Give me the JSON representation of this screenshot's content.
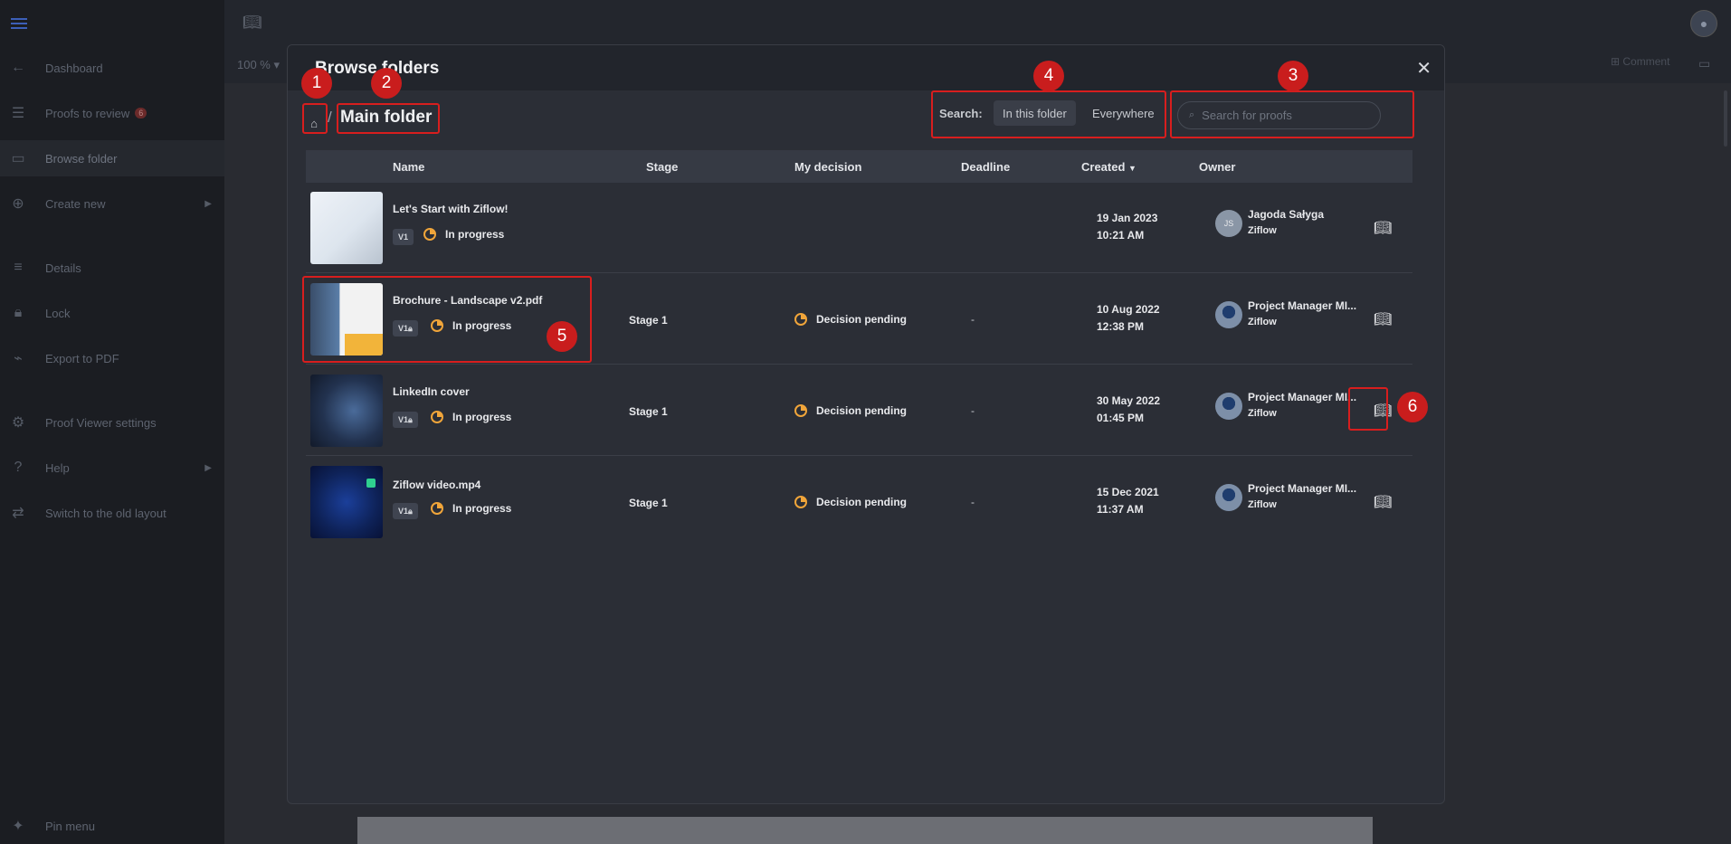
{
  "sidebar": {
    "items": [
      {
        "label": "Dashboard",
        "icon": "arrow-left-icon"
      },
      {
        "label": "Proofs to review",
        "icon": "checklist-icon",
        "badge": "6"
      },
      {
        "label": "Browse folder",
        "icon": "folder-icon"
      },
      {
        "label": "Create new",
        "icon": "plus-circle-icon"
      },
      {
        "label": "Details",
        "icon": "list-icon"
      },
      {
        "label": "Lock",
        "icon": "lock-icon"
      },
      {
        "label": "Export to PDF",
        "icon": "pdf-icon"
      },
      {
        "label": "Proof Viewer settings",
        "icon": "gear-icon"
      },
      {
        "label": "Help",
        "icon": "help-icon"
      },
      {
        "label": "Switch to the old layout",
        "icon": "switch-icon"
      }
    ],
    "pin_label": "Pin menu"
  },
  "toolbar": {
    "zoom": "100 %",
    "comment_label": "Comment"
  },
  "modal": {
    "title": "Browse folders",
    "breadcrumb": "Main folder",
    "search_label": "Search:",
    "scope_in_folder": "In this folder",
    "scope_everywhere": "Everywhere",
    "search_placeholder": "Search for proofs"
  },
  "table": {
    "headers": {
      "name": "Name",
      "stage": "Stage",
      "decision": "My decision",
      "deadline": "Deadline",
      "created": "Created",
      "owner": "Owner"
    },
    "rows": [
      {
        "name": "Let's Start with Ziflow!",
        "version": "V1",
        "status": "In progress",
        "stage": "",
        "decision": "",
        "deadline": "",
        "created_date": "19 Jan 2023",
        "created_time": "10:21 AM",
        "owner": "Jagoda Sałyga",
        "owner_initials": "JS",
        "org": "Ziflow"
      },
      {
        "name": "Brochure - Landscape v2.pdf",
        "version": "V1",
        "status": "In progress",
        "stage": "Stage 1",
        "decision": "Decision pending",
        "deadline": "-",
        "created_date": "10 Aug 2022",
        "created_time": "12:38 PM",
        "owner": "Project Manager MI...",
        "org": "Ziflow"
      },
      {
        "name": "LinkedIn cover",
        "version": "V1",
        "status": "In progress",
        "stage": "Stage 1",
        "decision": "Decision pending",
        "deadline": "-",
        "created_date": "30 May 2022",
        "created_time": "01:45 PM",
        "owner": "Project Manager MI...",
        "org": "Ziflow"
      },
      {
        "name": "Ziflow video.mp4",
        "version": "V1",
        "status": "In progress",
        "stage": "Stage 1",
        "decision": "Decision pending",
        "deadline": "-",
        "created_date": "15 Dec 2021",
        "created_time": "11:37 AM",
        "owner": "Project Manager MI...",
        "org": "Ziflow"
      }
    ]
  },
  "markers": [
    "1",
    "2",
    "3",
    "4",
    "5",
    "6"
  ],
  "colors": {
    "highlight": "#d81e1e",
    "pending": "#f0a53a",
    "accent": "#3c5fb8"
  }
}
